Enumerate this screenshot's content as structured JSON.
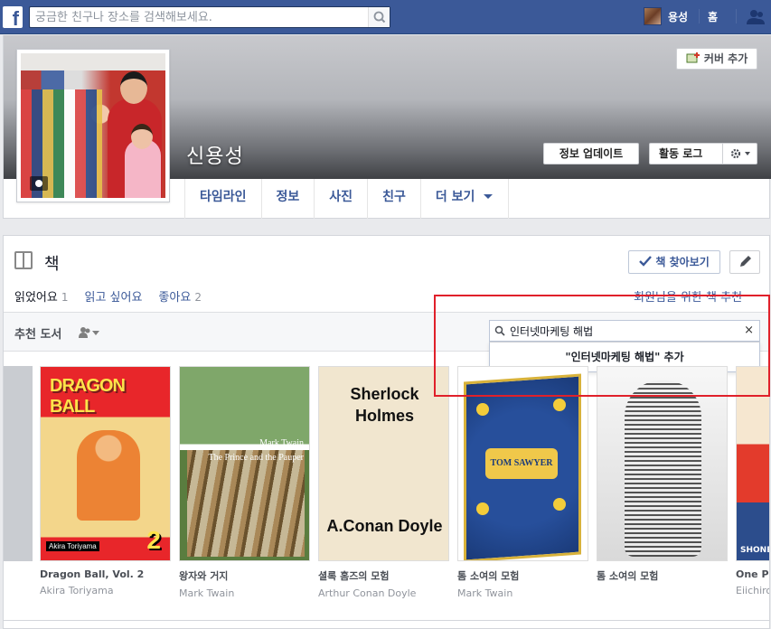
{
  "topbar": {
    "logo": "f",
    "search_placeholder": "궁금한 친구나 장소를 검색해보세요.",
    "user_name": "용성",
    "home": "홈"
  },
  "profile": {
    "name": "신용성",
    "add_cover": "커버 추가",
    "update_info": "정보 업데이트",
    "activity_log": "활동 로그",
    "nav": [
      "타임라인",
      "정보",
      "사진",
      "친구",
      "더 보기"
    ]
  },
  "books": {
    "title": "책",
    "find_books": "책 찾아보기",
    "tabs": [
      {
        "label": "읽었어요",
        "count": "1"
      },
      {
        "label": "읽고 싶어요",
        "count": ""
      },
      {
        "label": "좋아요",
        "count": "2"
      }
    ],
    "recommend_link": "회원님을 위한 책 추천",
    "recommended_title": "추천 도서",
    "search_value": "인터넷마케팅 해법",
    "suggestion": "\"인터넷마케팅 해법\" 추가",
    "items": [
      {
        "title": "Dragon Ball, Vol. 2",
        "author": "Akira Toriyama",
        "cover_text": "DRAGON BALL",
        "cover_sub": "Akira Toriyama",
        "cover_vol": "2"
      },
      {
        "title": "왕자와 거지",
        "author": "Mark Twain",
        "cover_text": "Mark Twain",
        "cover_sub": "The Prince and the Pauper"
      },
      {
        "title": "셜록 홈즈의 모험",
        "author": "Arthur Conan Doyle",
        "cover_text": "Sherlock Holmes",
        "cover_sub": "A.Conan Doyle"
      },
      {
        "title": "톰 소여의 모험",
        "author": "Mark Twain",
        "cover_text": "TOM SAWYER"
      },
      {
        "title": "톰 소여의 모험",
        "author": ""
      },
      {
        "title": "One Piece",
        "author": "Eiichiro Oda",
        "cover_text": "SHONEN JUMP"
      }
    ]
  },
  "colors": {
    "brand": "#3b5998",
    "highlight": "#e0202a"
  }
}
